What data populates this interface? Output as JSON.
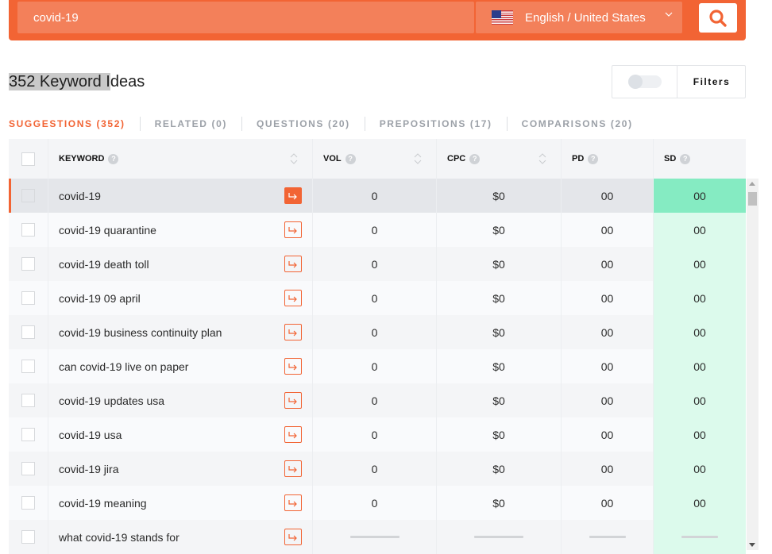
{
  "search": {
    "query": "covid-19",
    "language_label": "English / United States",
    "flag_icon": "us-flag-icon",
    "search_icon": "search-icon"
  },
  "colors": {
    "brand": "#f26434",
    "sd_green": "#85ebc2",
    "sd_light_green": "#dcfaec"
  },
  "heading": {
    "highlighted": "352 Keyword I",
    "rest": "deas"
  },
  "filters": {
    "toggle_on": false,
    "label": "Filters"
  },
  "tabs": [
    {
      "label": "SUGGESTIONS (352)",
      "active": true
    },
    {
      "label": "RELATED (0)",
      "active": false
    },
    {
      "label": "QUESTIONS (20)",
      "active": false
    },
    {
      "label": "PREPOSITIONS (17)",
      "active": false
    },
    {
      "label": "COMPARISONS (20)",
      "active": false
    }
  ],
  "table": {
    "columns": {
      "keyword": "KEYWORD",
      "vol": "VOL",
      "cpc": "CPC",
      "pd": "PD",
      "sd": "SD"
    },
    "rows": [
      {
        "keyword": "covid-19",
        "vol": "0",
        "cpc": "$0",
        "pd": "00",
        "sd": "00",
        "selected": true
      },
      {
        "keyword": "covid-19 quarantine",
        "vol": "0",
        "cpc": "$0",
        "pd": "00",
        "sd": "00"
      },
      {
        "keyword": "covid-19 death toll",
        "vol": "0",
        "cpc": "$0",
        "pd": "00",
        "sd": "00"
      },
      {
        "keyword": "covid-19 09 april",
        "vol": "0",
        "cpc": "$0",
        "pd": "00",
        "sd": "00"
      },
      {
        "keyword": "covid-19 business continuity plan",
        "vol": "0",
        "cpc": "$0",
        "pd": "00",
        "sd": "00"
      },
      {
        "keyword": "can covid-19 live on paper",
        "vol": "0",
        "cpc": "$0",
        "pd": "00",
        "sd": "00"
      },
      {
        "keyword": "covid-19 updates usa",
        "vol": "0",
        "cpc": "$0",
        "pd": "00",
        "sd": "00"
      },
      {
        "keyword": "covid-19 usa",
        "vol": "0",
        "cpc": "$0",
        "pd": "00",
        "sd": "00"
      },
      {
        "keyword": "covid-19 jira",
        "vol": "0",
        "cpc": "$0",
        "pd": "00",
        "sd": "00"
      },
      {
        "keyword": "covid-19 meaning",
        "vol": "0",
        "cpc": "$0",
        "pd": "00",
        "sd": "00"
      },
      {
        "keyword": "what covid-19 stands for",
        "vol": null,
        "cpc": null,
        "pd": null,
        "sd": null,
        "loading": true
      }
    ]
  }
}
